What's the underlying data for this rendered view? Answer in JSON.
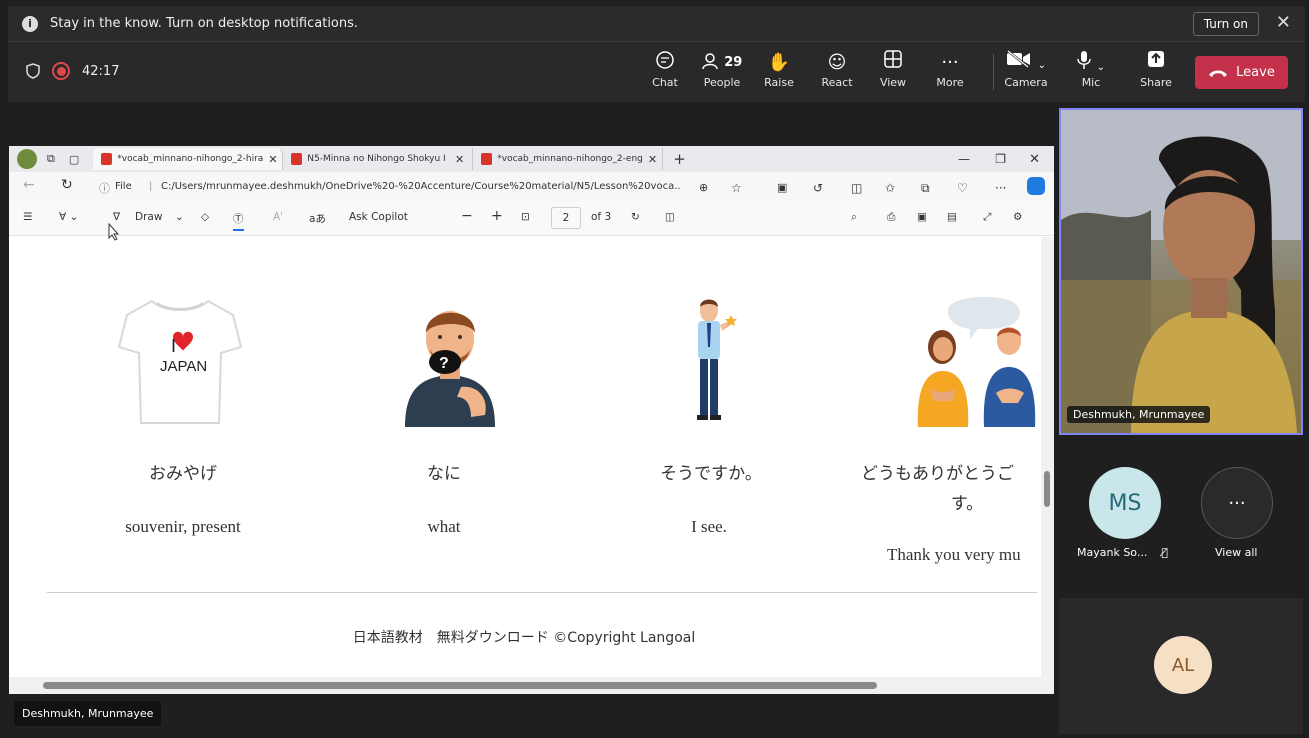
{
  "notification": {
    "message": "Stay in the know. Turn on desktop notifications.",
    "turn_on": "Turn on"
  },
  "meeting": {
    "timer": "42:17",
    "buttons": {
      "chat": "Chat",
      "people": "People",
      "people_count": "29",
      "raise": "Raise",
      "react": "React",
      "view": "View",
      "more": "More",
      "camera": "Camera",
      "mic": "Mic",
      "share": "Share",
      "leave": "Leave"
    }
  },
  "browser": {
    "tabs": [
      "*vocab_minnano-nihongo_2-hira",
      "N5-Minna no Nihongo Shokyu I",
      "*vocab_minnano-nihongo_2-eng"
    ],
    "address": "C:/Users/mrunmayee.deshmukh/OneDrive%20-%20Accenture/Course%20material/N5/Lesson%20voca...",
    "address_prefix": "File",
    "pdf_toolbar": {
      "draw": "Draw",
      "ask_copilot": "Ask Copilot",
      "page": "2",
      "of_pages": "of 3"
    }
  },
  "vocab": [
    {
      "jp": "おみやげ",
      "en": "souvenir, present",
      "illustration": "tshirt"
    },
    {
      "jp": "なに",
      "en": "what",
      "illustration": "thinking-man"
    },
    {
      "jp": "そうですか。",
      "en": "I see.",
      "illustration": "man-standing"
    },
    {
      "jp": "どうもありがとうご",
      "jp_line2": "す。",
      "en": "Thank you very mu",
      "illustration": "two-people-talking"
    }
  ],
  "tshirt_text": {
    "line1": "I",
    "line2": "JAPAN"
  },
  "footer": "日本語教材　無料ダウンロード ©Copyright Langoal",
  "participants": {
    "presenter_name": "Deshmukh, Mrunmayee",
    "ms_initials": "MS",
    "ms_name": "Mayank So...",
    "view_all": "View all",
    "al_initials": "AL"
  },
  "colors": {
    "leave": "#c4314b",
    "highlight": "#7f85f5",
    "ms_avatar": "#c9e7eb",
    "al_avatar": "#f6e0c5"
  }
}
